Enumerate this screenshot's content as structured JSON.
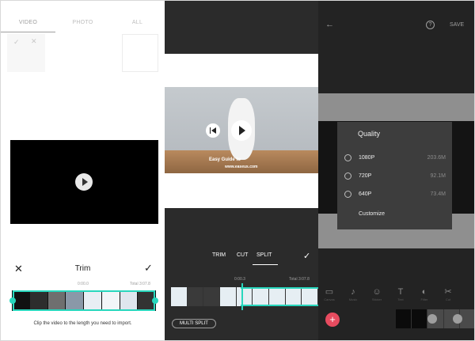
{
  "panel1": {
    "tabs": [
      {
        "label": "VIDEO",
        "active": true
      },
      {
        "label": "PHOTO",
        "active": false
      },
      {
        "label": "ALL",
        "active": false
      }
    ],
    "select_check": "✓",
    "select_close": "✕",
    "trim": {
      "close": "✕",
      "title": "Trim",
      "confirm": "✓",
      "current_time": "0:00.0",
      "total": "Total 3:07.8"
    },
    "hint": "Clip the video to the length you need to import."
  },
  "panel2": {
    "tabs": [
      "TRIM",
      "CUT",
      "SPLIT"
    ],
    "active_tab": "SPLIT",
    "confirm": "✓",
    "watermark_line1": "Easy Guide to",
    "watermark_line2": "www.easeus.com",
    "current_time": "0:00.3",
    "total": "Total 3:07.8",
    "multi_split": "MULTI SPLIT"
  },
  "panel3": {
    "back": "←",
    "help": "?",
    "save": "SAVE",
    "quality": {
      "title": "Quality",
      "options": [
        {
          "label": "1080P",
          "size": "203.6M"
        },
        {
          "label": "720P",
          "size": "92.1M"
        },
        {
          "label": "640P",
          "size": "73.4M"
        }
      ],
      "customize": "Customize"
    },
    "tools": [
      {
        "icon": "▭",
        "label": "Canvas"
      },
      {
        "icon": "♪",
        "label": "Music"
      },
      {
        "icon": "☺",
        "label": "Sticker"
      },
      {
        "icon": "T",
        "label": "Text"
      },
      {
        "icon": "◐",
        "label": "Filter"
      },
      {
        "icon": "✂",
        "label": "Cut"
      }
    ],
    "add": "+"
  }
}
